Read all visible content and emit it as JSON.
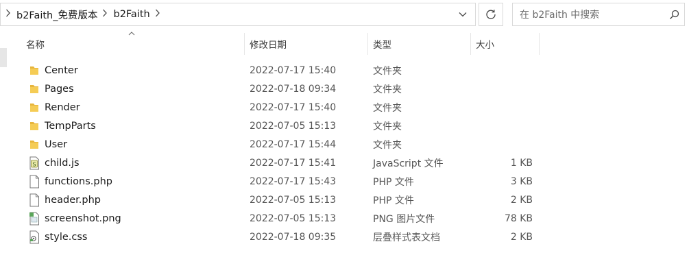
{
  "address": {
    "breadcrumbs": [
      "b2Faith_免费版本",
      "b2Faith"
    ]
  },
  "search": {
    "placeholder": "在 b2Faith 中搜索"
  },
  "columns": {
    "name": "名称",
    "date": "修改日期",
    "type": "类型",
    "size": "大小"
  },
  "files": [
    {
      "name": "Center",
      "date": "2022-07-17 15:40",
      "type": "文件夹",
      "size": "",
      "icon": "folder-icon"
    },
    {
      "name": "Pages",
      "date": "2022-07-18 09:34",
      "type": "文件夹",
      "size": "",
      "icon": "folder-icon"
    },
    {
      "name": "Render",
      "date": "2022-07-17 15:40",
      "type": "文件夹",
      "size": "",
      "icon": "folder-icon"
    },
    {
      "name": "TempParts",
      "date": "2022-07-05 15:13",
      "type": "文件夹",
      "size": "",
      "icon": "folder-icon"
    },
    {
      "name": "User",
      "date": "2022-07-17 15:44",
      "type": "文件夹",
      "size": "",
      "icon": "folder-icon"
    },
    {
      "name": "child.js",
      "date": "2022-07-17 15:41",
      "type": "JavaScript 文件",
      "size": "1 KB",
      "icon": "js-file-icon"
    },
    {
      "name": "functions.php",
      "date": "2022-07-17 15:43",
      "type": "PHP 文件",
      "size": "3 KB",
      "icon": "file-icon"
    },
    {
      "name": "header.php",
      "date": "2022-07-05 15:13",
      "type": "PHP 文件",
      "size": "2 KB",
      "icon": "file-icon"
    },
    {
      "name": "screenshot.png",
      "date": "2022-07-05 15:13",
      "type": "PNG 图片文件",
      "size": "78 KB",
      "icon": "image-file-icon"
    },
    {
      "name": "style.css",
      "date": "2022-07-18 09:35",
      "type": "层叠样式表文档",
      "size": "2 KB",
      "icon": "css-file-icon"
    }
  ],
  "colors": {
    "folder": "#f0c040",
    "border": "#d9d9d9",
    "text": "#1a1a1a",
    "muted": "#555555"
  }
}
